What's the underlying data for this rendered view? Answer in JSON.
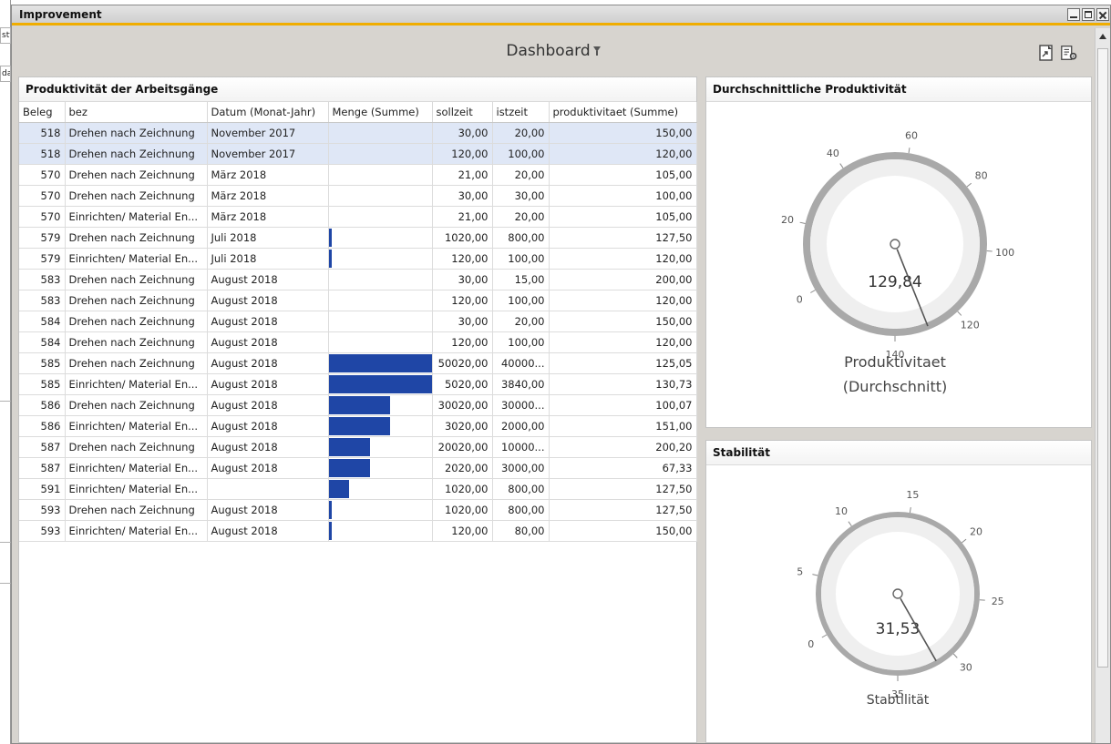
{
  "background": {
    "fragments": [
      "stv",
      "da"
    ]
  },
  "window": {
    "title": "Improvement"
  },
  "header": {
    "title": "Dashboard"
  },
  "icons": {
    "filter": "filter-icon",
    "export": "export-icon",
    "settings": "settings-icon"
  },
  "colors": {
    "accent": "#f0ad00",
    "bar": "#1f46a6",
    "selected_row": "#dfe7f6"
  },
  "table_panel": {
    "title": "Produktivität der Arbeitsgänge",
    "columns": [
      "Beleg",
      "bez",
      "Datum (Monat-Jahr)",
      "Menge (Summe)",
      "sollzeit",
      "istzeit",
      "produktivitaet (Summe)"
    ],
    "rows": [
      {
        "beleg": "518",
        "bez": "Drehen nach Zeichnung",
        "datum": "November 2017",
        "menge": 0,
        "sollzeit": "30,00",
        "istzeit": "20,00",
        "prod": "150,00",
        "selected": true
      },
      {
        "beleg": "518",
        "bez": "Drehen nach Zeichnung",
        "datum": "November 2017",
        "menge": 0,
        "sollzeit": "120,00",
        "istzeit": "100,00",
        "prod": "120,00",
        "selected": true
      },
      {
        "beleg": "570",
        "bez": "Drehen nach Zeichnung",
        "datum": "März 2018",
        "menge": 0,
        "sollzeit": "21,00",
        "istzeit": "20,00",
        "prod": "105,00",
        "selected": false
      },
      {
        "beleg": "570",
        "bez": "Drehen nach Zeichnung",
        "datum": "März 2018",
        "menge": 0,
        "sollzeit": "30,00",
        "istzeit": "30,00",
        "prod": "100,00",
        "selected": false
      },
      {
        "beleg": "570",
        "bez": "Einrichten/ Material En...",
        "datum": "März 2018",
        "menge": 0,
        "sollzeit": "21,00",
        "istzeit": "20,00",
        "prod": "105,00",
        "selected": false
      },
      {
        "beleg": "579",
        "bez": "Drehen nach Zeichnung",
        "datum": "Juli 2018",
        "menge": 0.02,
        "sollzeit": "1020,00",
        "istzeit": "800,00",
        "prod": "127,50",
        "selected": false
      },
      {
        "beleg": "579",
        "bez": "Einrichten/ Material En...",
        "datum": "Juli 2018",
        "menge": 0.02,
        "sollzeit": "120,00",
        "istzeit": "100,00",
        "prod": "120,00",
        "selected": false
      },
      {
        "beleg": "583",
        "bez": "Drehen nach Zeichnung",
        "datum": "August 2018",
        "menge": 0,
        "sollzeit": "30,00",
        "istzeit": "15,00",
        "prod": "200,00",
        "selected": false
      },
      {
        "beleg": "583",
        "bez": "Drehen nach Zeichnung",
        "datum": "August 2018",
        "menge": 0,
        "sollzeit": "120,00",
        "istzeit": "100,00",
        "prod": "120,00",
        "selected": false
      },
      {
        "beleg": "584",
        "bez": "Drehen nach Zeichnung",
        "datum": "August 2018",
        "menge": 0,
        "sollzeit": "30,00",
        "istzeit": "20,00",
        "prod": "150,00",
        "selected": false
      },
      {
        "beleg": "584",
        "bez": "Drehen nach Zeichnung",
        "datum": "August 2018",
        "menge": 0,
        "sollzeit": "120,00",
        "istzeit": "100,00",
        "prod": "120,00",
        "selected": false
      },
      {
        "beleg": "585",
        "bez": "Drehen nach Zeichnung",
        "datum": "August 2018",
        "menge": 1.0,
        "sollzeit": "50020,00",
        "istzeit": "40000...",
        "prod": "125,05",
        "selected": false
      },
      {
        "beleg": "585",
        "bez": "Einrichten/ Material En...",
        "datum": "August 2018",
        "menge": 1.0,
        "sollzeit": "5020,00",
        "istzeit": "3840,00",
        "prod": "130,73",
        "selected": false
      },
      {
        "beleg": "586",
        "bez": "Drehen nach Zeichnung",
        "datum": "August 2018",
        "menge": 0.6,
        "sollzeit": "30020,00",
        "istzeit": "30000...",
        "prod": "100,07",
        "selected": false
      },
      {
        "beleg": "586",
        "bez": "Einrichten/ Material En...",
        "datum": "August 2018",
        "menge": 0.6,
        "sollzeit": "3020,00",
        "istzeit": "2000,00",
        "prod": "151,00",
        "selected": false
      },
      {
        "beleg": "587",
        "bez": "Drehen nach Zeichnung",
        "datum": "August 2018",
        "menge": 0.4,
        "sollzeit": "20020,00",
        "istzeit": "10000...",
        "prod": "200,20",
        "selected": false
      },
      {
        "beleg": "587",
        "bez": "Einrichten/ Material En...",
        "datum": "August 2018",
        "menge": 0.4,
        "sollzeit": "2020,00",
        "istzeit": "3000,00",
        "prod": "67,33",
        "selected": false
      },
      {
        "beleg": "591",
        "bez": "Einrichten/ Material En...",
        "datum": "",
        "menge": 0.2,
        "sollzeit": "1020,00",
        "istzeit": "800,00",
        "prod": "127,50",
        "selected": false
      },
      {
        "beleg": "593",
        "bez": "Drehen nach Zeichnung",
        "datum": "August 2018",
        "menge": 0.02,
        "sollzeit": "1020,00",
        "istzeit": "800,00",
        "prod": "127,50",
        "selected": false
      },
      {
        "beleg": "593",
        "bez": "Einrichten/ Material En...",
        "datum": "August 2018",
        "menge": 0.02,
        "sollzeit": "120,00",
        "istzeit": "80,00",
        "prod": "150,00",
        "selected": false
      }
    ]
  },
  "gauge1": {
    "title": "Durchschnittliche Produktivität",
    "value": 129.84,
    "value_text": "129,84",
    "min": 0,
    "max": 140,
    "ticks": [
      "0",
      "20",
      "40",
      "60",
      "80",
      "100",
      "120",
      "140"
    ],
    "label_line1": "Produktivitaet",
    "label_line2": "(Durchschnitt)"
  },
  "gauge2": {
    "title": "Stabilität",
    "value": 31.53,
    "value_text": "31,53",
    "min": 0,
    "max": 35,
    "ticks": [
      "0",
      "5",
      "10",
      "15",
      "20",
      "25",
      "30",
      "35"
    ],
    "label_line1": "Stabtilität"
  }
}
